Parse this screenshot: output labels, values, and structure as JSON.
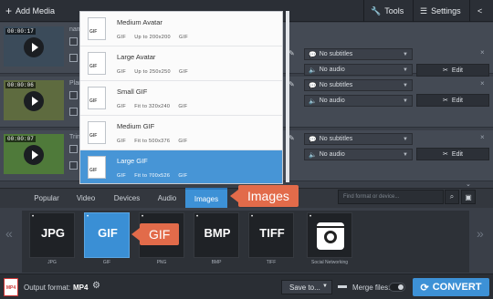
{
  "toolbar": {
    "add_media": "Add Media",
    "tools": "Tools",
    "settings": "Settings"
  },
  "rows": [
    {
      "time": "00:00:17",
      "name": "nam",
      "subtitles": "No subtitles",
      "audio": "No audio",
      "edit": "Edit"
    },
    {
      "time": "00:00:06",
      "name": "Plar",
      "subtitles": "No subtitles",
      "audio": "No audio",
      "edit": "Edit"
    },
    {
      "time": "00:00:07",
      "name": "Trin",
      "subtitles": "No subtitles",
      "audio": "No audio",
      "edit": "Edit"
    }
  ],
  "dropdown": {
    "items": [
      {
        "title": "Medium Avatar",
        "detail": "GIF     Up to 200x200     GIF"
      },
      {
        "title": "Large Avatar",
        "detail": "GIF     Up to 250x250     GIF"
      },
      {
        "title": "Small GIF",
        "detail": "GIF     Fit to 320x240     GIF"
      },
      {
        "title": "Medium GIF",
        "detail": "GIF     Fit to 500x376     GIF"
      },
      {
        "title": "Large GIF",
        "detail": "GIF     Fit to 700x526     GIF"
      }
    ],
    "selected_index": 4
  },
  "tabs": [
    "Popular",
    "Video",
    "Devices",
    "Audio",
    "Images"
  ],
  "active_tab": "Images",
  "search": {
    "placeholder": "Find format or device..."
  },
  "formats": [
    {
      "big": "JPG",
      "label": "JPG"
    },
    {
      "big": "GIF",
      "label": "GIF"
    },
    {
      "big": "",
      "label": "PNG"
    },
    {
      "big": "BMP",
      "label": "BMP"
    },
    {
      "big": "TIFF",
      "label": "TIFF"
    },
    {
      "big": "",
      "label": "Social Networking"
    }
  ],
  "callouts": {
    "images": "Images",
    "gif": "GIF"
  },
  "bottom": {
    "output_label": "Output format:",
    "output_value": "MP4",
    "save_to": "Save to...",
    "merge_files": "Merge files:",
    "convert": "CONVERT"
  },
  "colors": {
    "accent": "#3d91d6",
    "callout": "#e26b4a",
    "selected_row": "#4795d6"
  }
}
